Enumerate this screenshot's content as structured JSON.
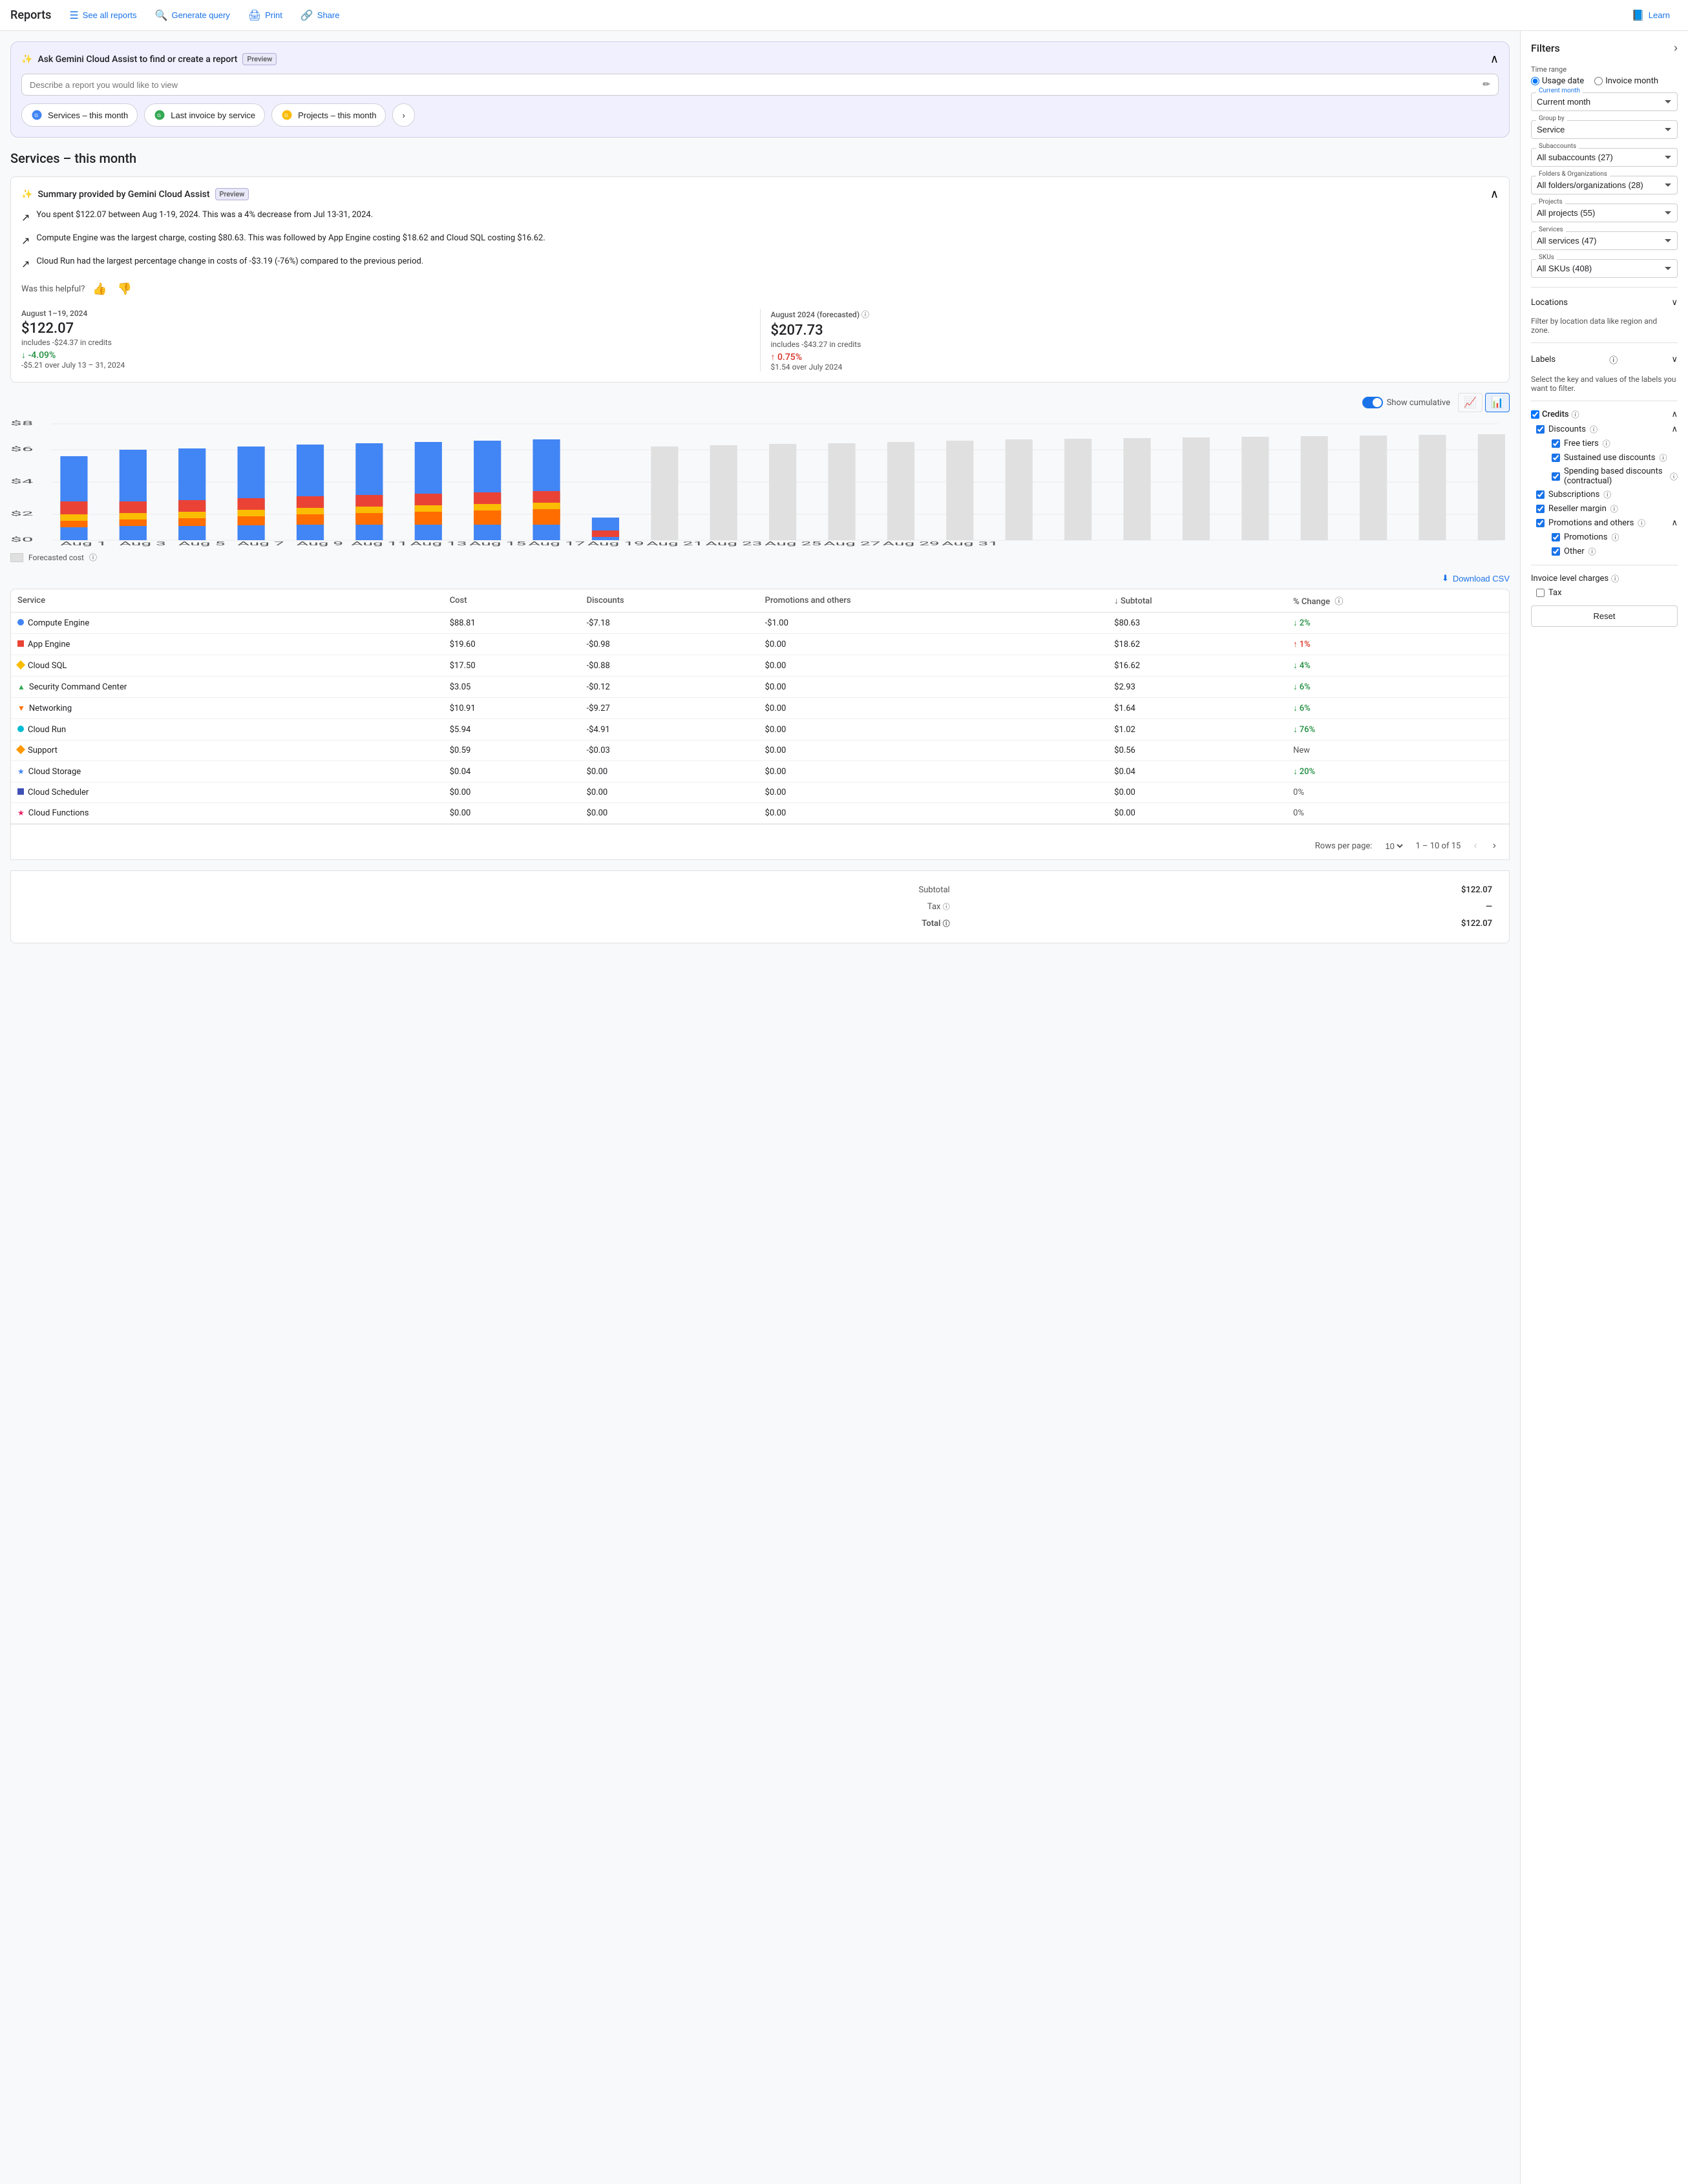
{
  "nav": {
    "title": "Reports",
    "buttons": [
      {
        "id": "see-all-reports",
        "label": "See all reports",
        "icon": "☰"
      },
      {
        "id": "generate-query",
        "label": "Generate query",
        "icon": "🔍"
      },
      {
        "id": "print",
        "label": "Print",
        "icon": "🖨"
      },
      {
        "id": "share",
        "label": "Share",
        "icon": "🔗"
      },
      {
        "id": "learn",
        "label": "Learn",
        "icon": "📘"
      }
    ]
  },
  "gemini": {
    "title": "Ask Gemini Cloud Assist to find or create a report",
    "badge": "Preview",
    "placeholder": "Describe a report you would like to view",
    "quickReports": [
      {
        "label": "Services – this month"
      },
      {
        "label": "Last invoice by service"
      },
      {
        "label": "Projects – this month"
      }
    ]
  },
  "pageTitle": "Services – this month",
  "summary": {
    "title": "Summary provided by Gemini Cloud Assist",
    "badge": "Preview",
    "bullets": [
      "You spent $122.07 between Aug 1-19, 2024. This was a 4% decrease from Jul 13-31, 2024.",
      "Compute Engine was the largest charge, costing $80.63. This was followed by App Engine costing $18.62 and Cloud SQL costing $16.62.",
      "Cloud Run had the largest percentage change in costs of -$3.19 (-76%) compared to the previous period."
    ],
    "helpful": "Was this helpful?"
  },
  "stats": {
    "current": {
      "period": "August 1–19, 2024",
      "amount": "$122.07",
      "credits": "includes -$24.37 in credits",
      "changePercent": "↓ -4.09%",
      "changeType": "down",
      "changeSub": "-$5.21 over July 13 – 31, 2024"
    },
    "forecasted": {
      "period": "August 2024 (forecasted)",
      "amount": "$207.73",
      "credits": "includes -$43.27 in credits",
      "changePercent": "↑ 0.75%",
      "changeType": "up",
      "changeSub": "$1.54 over July 2024"
    }
  },
  "chart": {
    "yMax": "$8",
    "yMid": "$6",
    "yMid2": "$4",
    "yMin": "$2",
    "yZero": "$0",
    "showCumulative": "Show cumulative",
    "forecastedCost": "Forecasted cost"
  },
  "table": {
    "downloadLabel": "Download CSV",
    "headers": [
      "Service",
      "Cost",
      "Discounts",
      "Promotions and others",
      "Subtotal",
      "% Change"
    ],
    "rows": [
      {
        "service": "Compute Engine",
        "colorType": "dot",
        "color": "#4285f4",
        "cost": "$88.81",
        "discounts": "-$7.18",
        "promotions": "-$1.00",
        "subtotal": "$80.63",
        "change": "↓ 2%",
        "changeType": "down"
      },
      {
        "service": "App Engine",
        "colorType": "square",
        "color": "#ea4335",
        "cost": "$19.60",
        "discounts": "-$0.98",
        "promotions": "$0.00",
        "subtotal": "$18.62",
        "change": "↑ 1%",
        "changeType": "up"
      },
      {
        "service": "Cloud SQL",
        "colorType": "diamond",
        "color": "#fbbc04",
        "cost": "$17.50",
        "discounts": "-$0.88",
        "promotions": "$0.00",
        "subtotal": "$16.62",
        "change": "↓ 4%",
        "changeType": "down"
      },
      {
        "service": "Security Command Center",
        "colorType": "triangle",
        "color": "#34a853",
        "cost": "$3.05",
        "discounts": "-$0.12",
        "promotions": "$0.00",
        "subtotal": "$2.93",
        "change": "↓ 6%",
        "changeType": "down"
      },
      {
        "service": "Networking",
        "colorType": "triangle-down",
        "color": "#ff6d00",
        "cost": "$10.91",
        "discounts": "-$9.27",
        "promotions": "$0.00",
        "subtotal": "$1.64",
        "change": "↓ 6%",
        "changeType": "down"
      },
      {
        "service": "Cloud Run",
        "colorType": "dot",
        "color": "#00bcd4",
        "cost": "$5.94",
        "discounts": "-$4.91",
        "promotions": "$0.00",
        "subtotal": "$1.02",
        "change": "↓ 76%",
        "changeType": "down"
      },
      {
        "service": "Support",
        "colorType": "diamond",
        "color": "#ff9800",
        "cost": "$0.59",
        "discounts": "-$0.03",
        "promotions": "$0.00",
        "subtotal": "$0.56",
        "change": "New",
        "changeType": "neutral"
      },
      {
        "service": "Cloud Storage",
        "colorType": "star",
        "color": "#4285f4",
        "cost": "$0.04",
        "discounts": "$0.00",
        "promotions": "$0.00",
        "subtotal": "$0.04",
        "change": "↓ 20%",
        "changeType": "down"
      },
      {
        "service": "Cloud Scheduler",
        "colorType": "square",
        "color": "#3f51b5",
        "cost": "$0.00",
        "discounts": "$0.00",
        "promotions": "$0.00",
        "subtotal": "$0.00",
        "change": "0%",
        "changeType": "neutral"
      },
      {
        "service": "Cloud Functions",
        "colorType": "star",
        "color": "#e91e63",
        "cost": "$0.00",
        "discounts": "$0.00",
        "promotions": "$0.00",
        "subtotal": "$0.00",
        "change": "0%",
        "changeType": "neutral"
      }
    ],
    "pagination": {
      "rowsLabel": "Rows per page:",
      "rowsValue": "10",
      "info": "1 – 10 of 15"
    }
  },
  "totals": {
    "subtotalLabel": "Subtotal",
    "subtotalValue": "$122.07",
    "taxLabel": "Tax",
    "taxValue": "—",
    "totalLabel": "Total",
    "totalValue": "$122.07"
  },
  "filters": {
    "title": "Filters",
    "timeRange": {
      "label": "Time range",
      "usageDateLabel": "Usage date",
      "invoiceMonthLabel": "Invoice month",
      "currentMonth": "Current month"
    },
    "groupBy": {
      "label": "Group by",
      "value": "Service"
    },
    "subaccounts": {
      "label": "Subaccounts",
      "value": "All subaccounts (27)"
    },
    "folders": {
      "label": "Folders & Organizations",
      "value": "All folders/organizations (28)"
    },
    "projects": {
      "label": "Projects",
      "value": "All projects (55)"
    },
    "services": {
      "label": "Services",
      "value": "All services (47)"
    },
    "skus": {
      "label": "SKUs",
      "value": "All SKUs (408)"
    },
    "locations": {
      "label": "Locations",
      "note": "Filter by location data like region and zone."
    },
    "labels": {
      "label": "Labels",
      "note": "Select the key and values of the labels you want to filter."
    },
    "credits": {
      "label": "Credits",
      "discounts": {
        "label": "Discounts",
        "items": [
          {
            "label": "Free tiers",
            "checked": true
          },
          {
            "label": "Sustained use discounts",
            "checked": true
          },
          {
            "label": "Spending based discounts (contractual)",
            "checked": true
          }
        ]
      },
      "subscriptions": {
        "label": "Subscriptions",
        "checked": true
      },
      "resellerMargin": {
        "label": "Reseller margin",
        "checked": true
      },
      "promotions": {
        "label": "Promotions and others",
        "items": [
          {
            "label": "Promotions",
            "checked": true
          },
          {
            "label": "Other",
            "checked": true
          }
        ]
      }
    },
    "invoiceLevel": {
      "label": "Invoice level charges",
      "items": [
        {
          "label": "Tax",
          "checked": false
        }
      ]
    },
    "resetLabel": "Reset"
  }
}
